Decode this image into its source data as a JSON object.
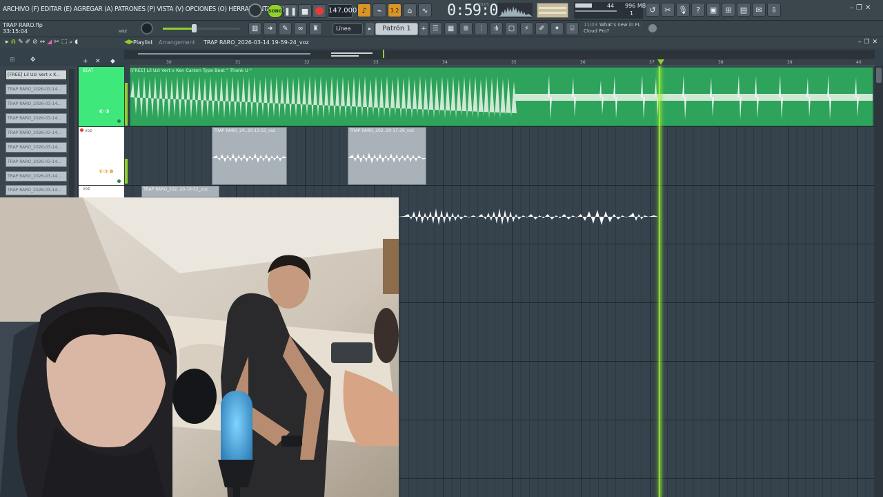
{
  "menu": {
    "text": "ARCHIVO (F) EDITAR (E) AGREGAR (A) PATRONES (P) VISTA (V) OPCIONES (O) HERRAMIENTAS (T) AYUDA"
  },
  "transport": {
    "song_mode": "SONG",
    "tempo": "147.000",
    "time": "0:59:05",
    "time_unit": "M:S:CS",
    "pattern_numbers": "3.2"
  },
  "resources": {
    "polyphony": "44",
    "memory": "996 MB",
    "cpu": "1"
  },
  "project": {
    "file": "TRAP RARO.flp",
    "elapsed": "33:15:04",
    "channel": "voz"
  },
  "toolbar": {
    "snap": "Línea",
    "pattern": "Patrón 1"
  },
  "news": {
    "date": "11/03",
    "title": "What's new in FL",
    "subtitle": "Cloud Pro?"
  },
  "playlist": {
    "title": "Playlist",
    "subtitle": "Arrangement",
    "breadcrumb": "TRAP RARO_2026-03-14 19-59-24_voz",
    "ruler": [
      "30",
      "31",
      "32",
      "33",
      "34",
      "35",
      "36",
      "37",
      "38",
      "39",
      "40"
    ]
  },
  "picker": {
    "first": "[FREE] Lil Uzi Vert x K..",
    "items": [
      "TRAP RARO_2026-03-14...",
      "TRAP RARO_2026-03-14...",
      "TRAP RARO_2026-03-14...",
      "TRAP RARO_2026-03-14...",
      "TRAP RARO_2026-03-14...",
      "TRAP RARO_2026-03-14...",
      "TRAP RARO_2026-03-14...",
      "TRAP RARO_2026-03-14..."
    ]
  },
  "tracks": {
    "beat": "BEAT",
    "voz": "voz",
    "voz2": "voz"
  },
  "clips": {
    "beat": "[FREE] Lil Uzi Vert x Ken Carson Type Beat  \" Thank U \"",
    "voz_a": "TRAP RARO_20..20-13-55_voz",
    "voz_b": "TRAP RARO_202..20-17-29_voz",
    "voz_c": "TRAP RARO_202..20-10-52_voz"
  },
  "colors": {
    "accent": "#8fd12c",
    "beat_track": "#3fe87a",
    "beat_clip": "#2ea35c",
    "grid": "#36434c",
    "record": "#e83a3a"
  }
}
